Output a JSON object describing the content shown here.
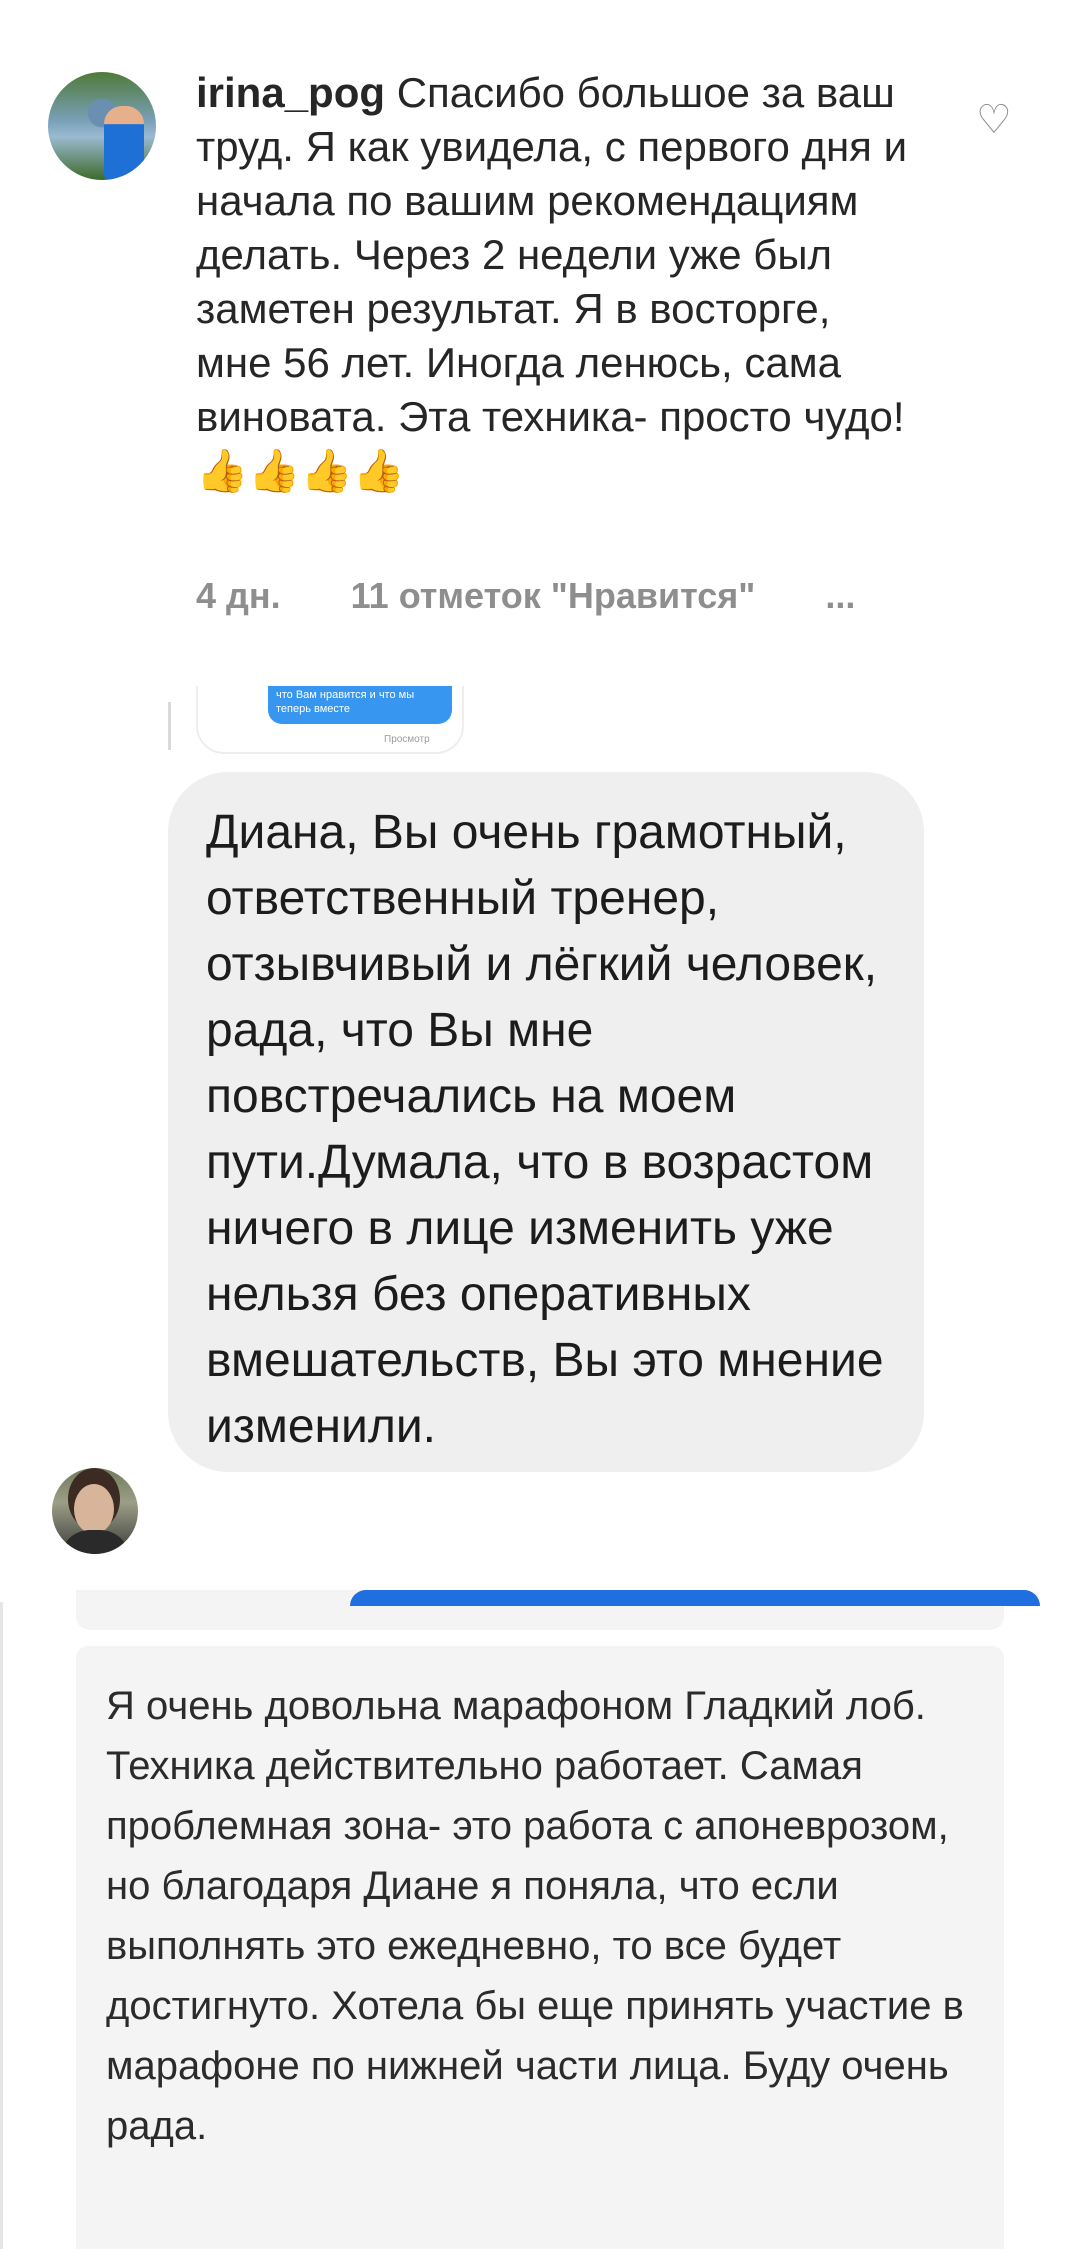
{
  "instagram_comment": {
    "username": "irina_pog",
    "text": "Спасибо большое за ваш труд. Я как увидела, с первого дня и начала по вашим рекомендациям делать. Через 2 недели уже был заметен результат. Я в восторге,  мне 56 лет. Иногда ленюсь, сама виновата. Эта техника- просто чудо!",
    "emoji": "👍👍👍👍",
    "time_ago": "4 дн.",
    "likes": "11 отметок \"Нравится\"",
    "more": "...",
    "like_icon": "heart-outline-icon"
  },
  "direct_message": {
    "thumbnail_text": "что Вам нравится и что мы теперь вместе",
    "thumbnail_status": "Просмотр",
    "message": "Диана, Вы очень грамотный, ответственный тренер, отзывчивый и лёгкий человек, рада, что Вы мне повстречались на моем пути.Думала, что в возрастом ничего в лице изменить уже нельзя без оперативных вмешательств, Вы это мнение изменили."
  },
  "review": {
    "text": "Я очень довольна марафоном Гладкий лоб. Техника действительно работает. Самая проблемная зона- это работа с апоневрозом, но благодаря Диане я поняла, что если выполнять это ежедневно, то все будет достигнуто. Хотела бы еще принять участие в марафоне по нижней части лица. Буду очень рада."
  },
  "colors": {
    "bubble_bg": "#efefef",
    "meta_gray": "#8e8e8e",
    "review_bg": "#f4f4f4",
    "accent_blue": "#1f6fe0"
  }
}
